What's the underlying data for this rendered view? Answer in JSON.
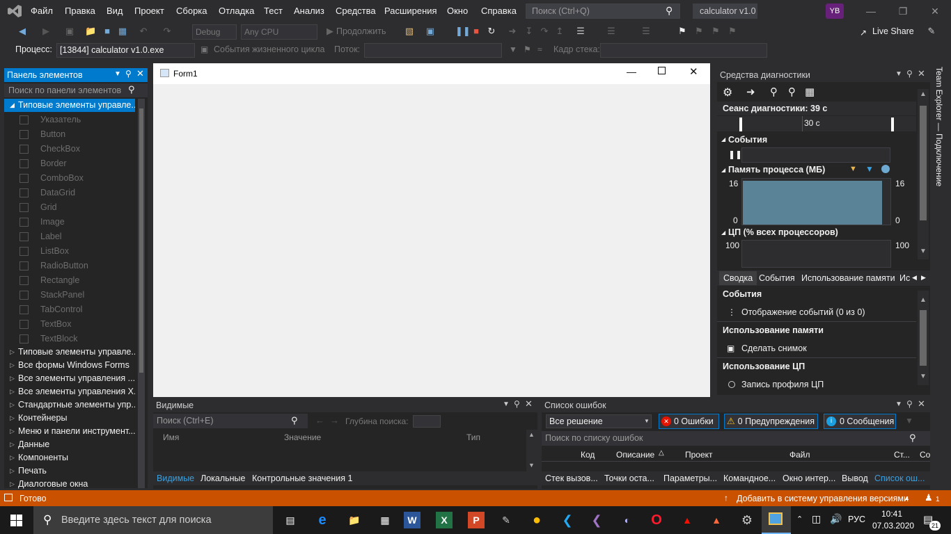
{
  "menubar": {
    "items": [
      "Файл",
      "Правка",
      "Вид",
      "Проект",
      "Сборка",
      "Отладка",
      "Тест",
      "Анализ",
      "Средства",
      "Расширения",
      "Окно",
      "Справка"
    ],
    "search_placeholder": "Поиск (Ctrl+Q)",
    "title": "calculator v1.0",
    "user_initials": "YB"
  },
  "toolbar": {
    "config": "Debug",
    "platform": "Any CPU",
    "continue_label": "Продолжить",
    "live_share": "Live Share"
  },
  "process_bar": {
    "process_label": "Процесс:",
    "process_value": "[13844] calculator v1.0.exe",
    "lifecycle_label": "События жизненного цикла",
    "thread_label": "Поток:",
    "stack_label": "Кадр стека:"
  },
  "toolbox": {
    "title": "Панель элементов",
    "search_placeholder": "Поиск по панели элементов",
    "expanded_category": "Типовые элементы управле...",
    "items": [
      "Указатель",
      "Button",
      "CheckBox",
      "Border",
      "ComboBox",
      "DataGrid",
      "Grid",
      "Image",
      "Label",
      "ListBox",
      "RadioButton",
      "Rectangle",
      "StackPanel",
      "TabControl",
      "TextBox",
      "TextBlock"
    ],
    "categories": [
      "Типовые элементы управле...",
      "Все формы Windows Forms",
      "Все элементы управления ...",
      "Все элементы управления X...",
      "Стандартные элементы упр...",
      "Контейнеры",
      "Меню и панели инструмент...",
      "Данные",
      "Компоненты",
      "Печать",
      "Диалоговые окна"
    ]
  },
  "designer": {
    "form_title": "Form1"
  },
  "diagnostics": {
    "title": "Средства диагностики",
    "session": "Сеанс диагностики: 39 с",
    "timeline_tick": "30 с",
    "events_header": "События",
    "memory_header": "Память процесса (МБ)",
    "memory_max": "16",
    "memory_min": "0",
    "cpu_header": "ЦП (% всех процессоров)",
    "cpu_max": "100",
    "memory_level": 0.95,
    "tabs": [
      "Сводка",
      "События",
      "Использование памяти",
      "Ис"
    ],
    "summary": {
      "events_title": "События",
      "events_item": "Отображение событий (0 из 0)",
      "memory_title": "Использование памяти",
      "memory_item": "Сделать снимок",
      "cpu_title": "Использование ЦП",
      "cpu_item": "Запись профиля ЦП"
    }
  },
  "locals": {
    "title": "Видимые",
    "search_placeholder": "Поиск (Ctrl+E)",
    "depth_label": "Глубина поиска:",
    "columns": [
      "Имя",
      "Значение",
      "Тип"
    ],
    "tabs": [
      "Видимые",
      "Локальные",
      "Контрольные значения 1"
    ]
  },
  "errors": {
    "title": "Список ошибок",
    "scope": "Все решение",
    "errors_btn": "0 Ошибки",
    "warnings_btn": "0 Предупреждения",
    "messages_btn": "0 Сообщения",
    "search_placeholder": "Поиск по списку ошибок",
    "columns": [
      "Код",
      "Описание",
      "Проект",
      "Файл",
      "Ст...",
      "Со"
    ],
    "tabs": [
      "Стек вызов...",
      "Точки оста...",
      "Параметры...",
      "Командное...",
      "Окно интер...",
      "Вывод",
      "Список ош..."
    ]
  },
  "side_tab": "Team Explorer — Подключение",
  "statusbar": {
    "status": "Готово",
    "source_control": "Добавить в систему управления версиями",
    "notifications": "1"
  },
  "taskbar": {
    "search_placeholder": "Введите здесь текст для поиска",
    "lang": "РУС",
    "time": "10:41",
    "date": "07.03.2020",
    "notif_count": "21"
  },
  "colors": {
    "accent": "#007acc",
    "statusbar": "#ca5100",
    "background": "#2d2d30",
    "panel": "#252526",
    "memory_graph": "#5b8398"
  }
}
